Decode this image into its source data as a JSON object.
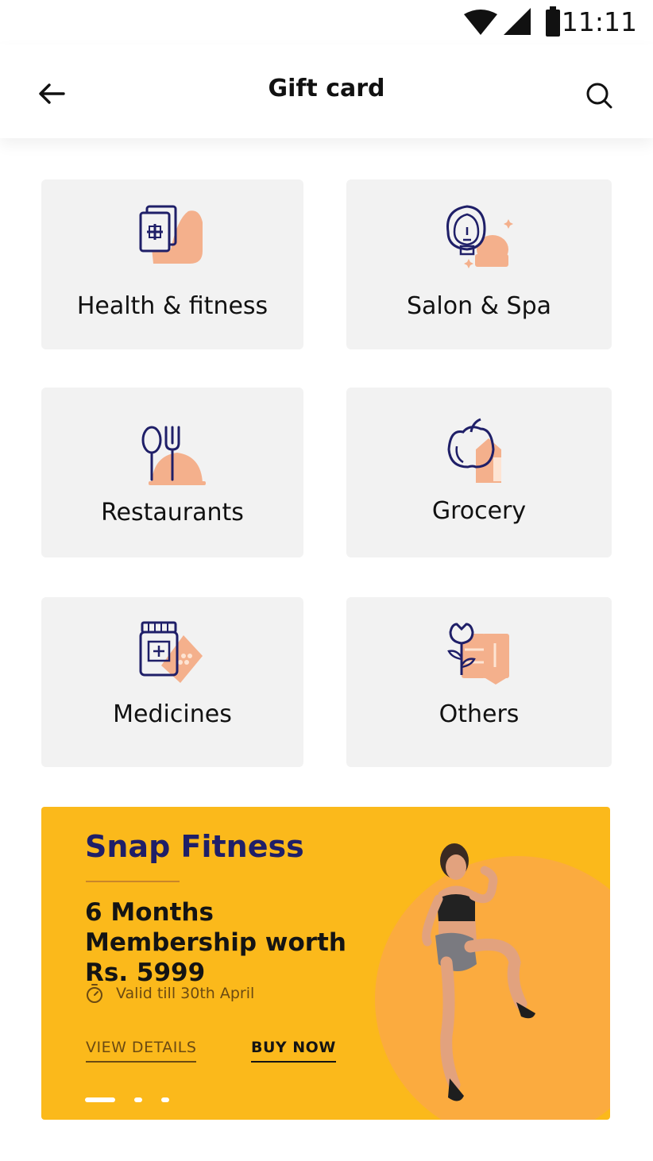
{
  "status_bar": {
    "time": "11:11"
  },
  "app_bar": {
    "title": "Gift card"
  },
  "categories": [
    {
      "label": "Health & fitness",
      "icon": "health-fitness-icon"
    },
    {
      "label": "Salon & Spa",
      "icon": "salon-spa-icon"
    },
    {
      "label": "Restaurants",
      "icon": "restaurants-icon"
    },
    {
      "label": "Grocery",
      "icon": "grocery-icon"
    },
    {
      "label": "Medicines",
      "icon": "medicines-icon"
    },
    {
      "label": "Others",
      "icon": "others-icon"
    }
  ],
  "promo": {
    "brand": "Snap Fitness",
    "offer": "6 Months Membership worth Rs. 5999",
    "validity": "Valid till 30th April",
    "view_details": "VIEW DETAILS",
    "buy_now": "BUY NOW",
    "carousel_pages": 3,
    "active_page": 1
  },
  "colors": {
    "navy": "#1f1f68",
    "peach": "#f4b08c",
    "tile_bg": "#f2f2f2",
    "promo_bg": "#fbb91b"
  }
}
